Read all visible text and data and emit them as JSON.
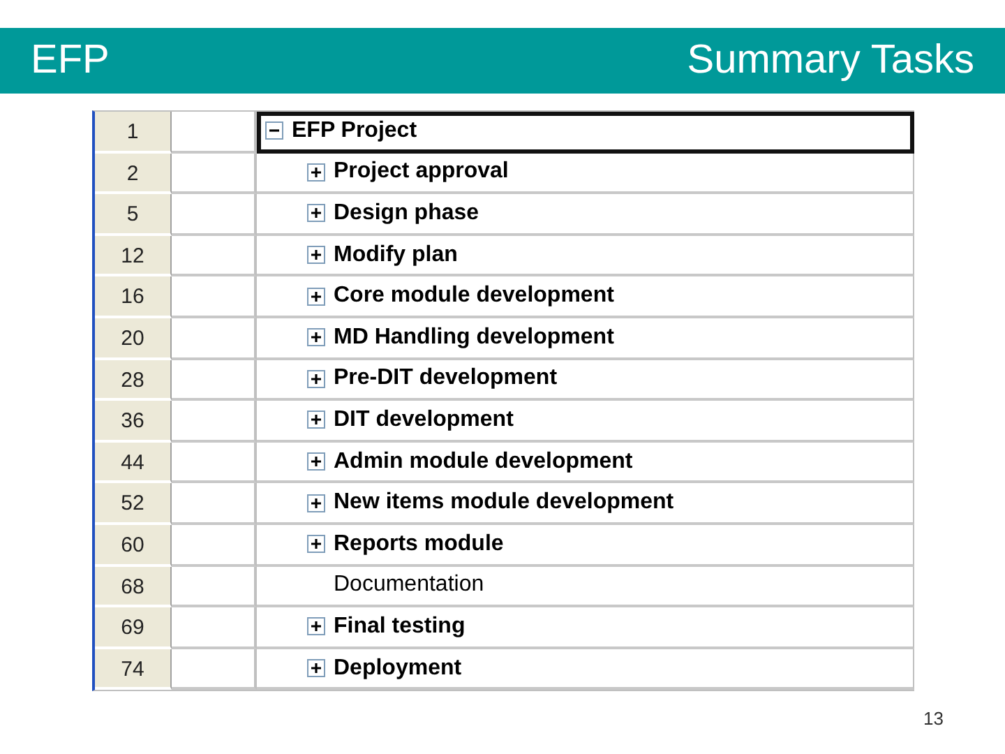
{
  "header": {
    "left": "EFP",
    "right": "Summary Tasks"
  },
  "table": {
    "rows": [
      {
        "id": "1",
        "name": "EFP Project",
        "kind": "summary",
        "expanded": true,
        "selected": true,
        "children": [
          {
            "id": "2",
            "name": "Project approval",
            "kind": "summary",
            "expanded": false,
            "selected": false
          },
          {
            "id": "5",
            "name": "Design phase",
            "kind": "summary",
            "expanded": false,
            "selected": false
          },
          {
            "id": "12",
            "name": "Modify plan",
            "kind": "summary",
            "expanded": false,
            "selected": false
          },
          {
            "id": "16",
            "name": "Core module development",
            "kind": "summary",
            "expanded": false,
            "selected": false
          },
          {
            "id": "20",
            "name": "MD Handling development",
            "kind": "summary",
            "expanded": false,
            "selected": false
          },
          {
            "id": "28",
            "name": "Pre-DIT development",
            "kind": "summary",
            "expanded": false,
            "selected": false
          },
          {
            "id": "36",
            "name": "DIT development",
            "kind": "summary",
            "expanded": false,
            "selected": false
          },
          {
            "id": "44",
            "name": "Admin module development",
            "kind": "summary",
            "expanded": false,
            "selected": false
          },
          {
            "id": "52",
            "name": "New items module development",
            "kind": "summary",
            "expanded": false,
            "selected": false
          },
          {
            "id": "60",
            "name": "Reports module",
            "kind": "summary",
            "expanded": false,
            "selected": false
          },
          {
            "id": "68",
            "name": "Documentation",
            "kind": "task",
            "selected": false
          },
          {
            "id": "69",
            "name": "Final testing",
            "kind": "summary",
            "expanded": false,
            "selected": false
          },
          {
            "id": "74",
            "name": "Deployment",
            "kind": "summary",
            "expanded": false,
            "selected": false
          }
        ]
      }
    ]
  },
  "page_number": "13"
}
